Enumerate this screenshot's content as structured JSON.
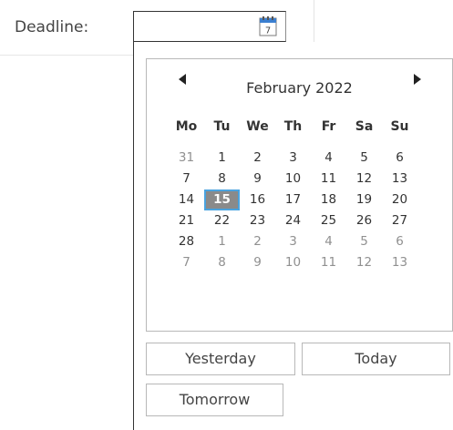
{
  "deadline": {
    "label": "Deadline:",
    "value": "",
    "calendar_icon": "calendar-icon"
  },
  "calendar": {
    "month_title": "February 2022",
    "prev_icon": "triangle-left-icon",
    "next_icon": "triangle-right-icon",
    "weekdays": [
      "Mo",
      "Tu",
      "We",
      "Th",
      "Fr",
      "Sa",
      "Su"
    ],
    "weeks": [
      [
        "31",
        "1",
        "2",
        "3",
        "4",
        "5",
        "6"
      ],
      [
        "7",
        "8",
        "9",
        "10",
        "11",
        "12",
        "13"
      ],
      [
        "14",
        "15",
        "16",
        "17",
        "18",
        "19",
        "20"
      ],
      [
        "21",
        "22",
        "23",
        "24",
        "25",
        "26",
        "27"
      ],
      [
        "28",
        "1",
        "2",
        "3",
        "4",
        "5",
        "6"
      ],
      [
        "7",
        "8",
        "9",
        "10",
        "11",
        "12",
        "13"
      ]
    ],
    "selected_day": "15",
    "colors": {
      "selected_fill": "#8a8a8a",
      "selected_outline": "#4aa3df",
      "other_month_text": "#909090"
    }
  },
  "quick_buttons": {
    "yesterday": "Yesterday",
    "today": "Today",
    "tomorrow": "Tomorrow"
  }
}
